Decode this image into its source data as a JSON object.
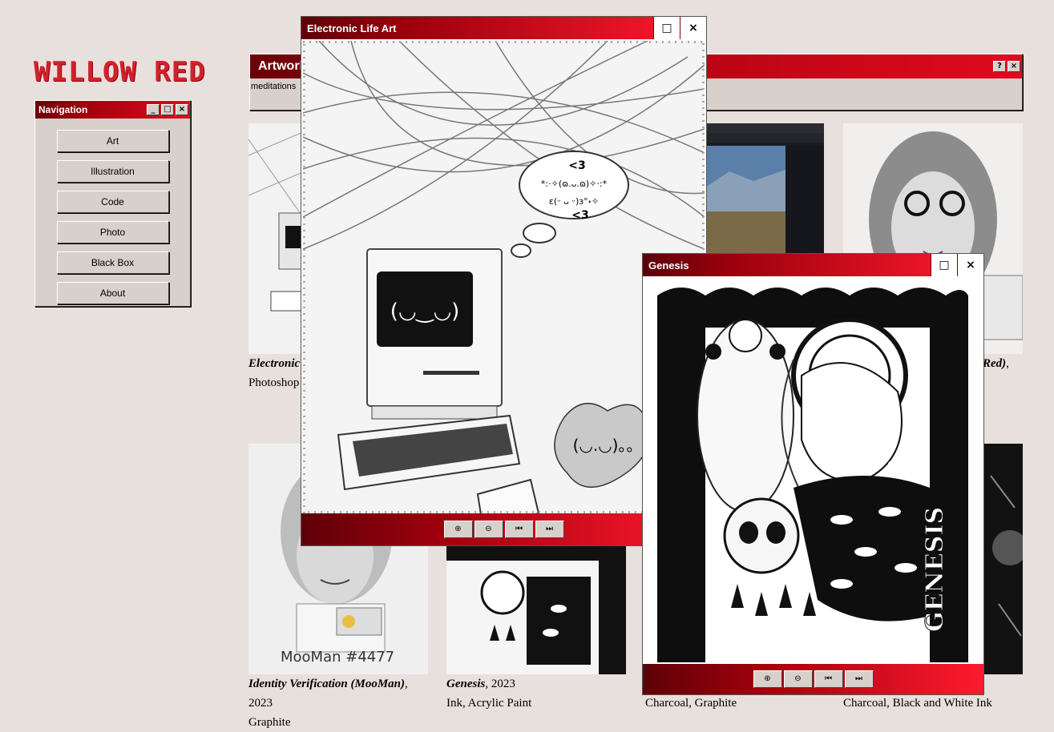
{
  "logo": "WILLOW RED",
  "colors": {
    "accent": "#d4202a",
    "titlebar_dark": "#6a0008",
    "titlebar_light": "#e00a1e",
    "window_face": "#d8d0ca",
    "desktop": "#e8e0dc"
  },
  "navigation": {
    "title": "Navigation",
    "items": [
      "Art",
      "Illustration",
      "Code",
      "Photo",
      "Black Box",
      "About"
    ]
  },
  "artwork_window": {
    "title": "Artwork",
    "subtitle": "meditations"
  },
  "gallery": {
    "electronic_caption_title": "Electronic",
    "electronic_caption_medium": "Photoshop",
    "right_caption_title_tail": "Red)",
    "identity": {
      "title": "Identity Verification (MooMan)",
      "year": "2023",
      "medium": "Graphite"
    },
    "genesis": {
      "title": "Genesis",
      "year": ", 2023",
      "medium": "Ink, Acrylic Paint"
    },
    "col3_medium": "Charcoal, Graphite",
    "col4_medium": "Charcoal, Black and White Ink",
    "mooman_sign": "MooMan #4477"
  },
  "electronic_viewer": {
    "title": "Electronic Life Art",
    "bubble_heart_top": "<3",
    "bubble_line1": "*:·✧(ɷ.ᴗ.ɷ)✧·:*",
    "bubble_line2": "ε(ᵕ ᴗ ᵕ)з°˖✧",
    "bubble_heart_bottom": "<3",
    "screen_face": "(◡‿◡)",
    "cloud_face": "(◡.◡)。。"
  },
  "genesis_viewer": {
    "title": "Genesis",
    "vertical_text": "GENESIS"
  },
  "viewer_controls": {
    "zoom_in": "⊕",
    "zoom_out": "⊖",
    "first": "⏮",
    "last": "⏭",
    "maximize": "□",
    "close": "×"
  }
}
